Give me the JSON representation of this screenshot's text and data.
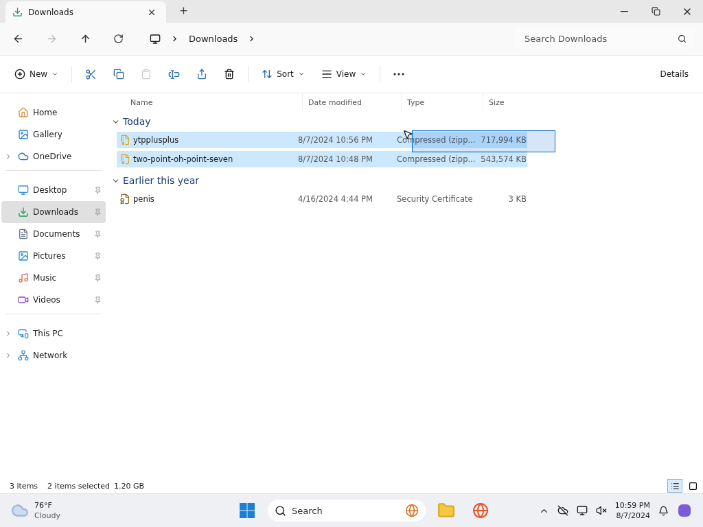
{
  "tab": {
    "title": "Downloads"
  },
  "address": {
    "crumbs": [
      "Downloads"
    ],
    "search_placeholder": "Search Downloads"
  },
  "toolbar": {
    "new": "New",
    "sort": "Sort",
    "view": "View",
    "details": "Details"
  },
  "sidebar": {
    "groups": [
      [
        {
          "label": "Home",
          "kind": "home",
          "expandable": false,
          "pinned": false,
          "selected": false
        },
        {
          "label": "Gallery",
          "kind": "gallery",
          "expandable": false,
          "pinned": false,
          "selected": false
        },
        {
          "label": "OneDrive",
          "kind": "cloud",
          "expandable": true,
          "pinned": false,
          "selected": false
        }
      ],
      [
        {
          "label": "Desktop",
          "kind": "desktop",
          "expandable": false,
          "pinned": true,
          "selected": false
        },
        {
          "label": "Downloads",
          "kind": "downloads",
          "expandable": false,
          "pinned": true,
          "selected": true
        },
        {
          "label": "Documents",
          "kind": "documents",
          "expandable": false,
          "pinned": true,
          "selected": false
        },
        {
          "label": "Pictures",
          "kind": "pictures",
          "expandable": false,
          "pinned": true,
          "selected": false
        },
        {
          "label": "Music",
          "kind": "music",
          "expandable": false,
          "pinned": true,
          "selected": false
        },
        {
          "label": "Videos",
          "kind": "videos",
          "expandable": false,
          "pinned": true,
          "selected": false
        }
      ],
      [
        {
          "label": "This PC",
          "kind": "pc",
          "expandable": true,
          "pinned": false,
          "selected": false
        },
        {
          "label": "Network",
          "kind": "network",
          "expandable": true,
          "pinned": false,
          "selected": false
        }
      ]
    ]
  },
  "columns": [
    "Name",
    "Date modified",
    "Type",
    "Size"
  ],
  "groups": [
    {
      "label": "Today",
      "expanded": true,
      "files": [
        {
          "name": "ytpplusplus",
          "date": "8/7/2024 10:56 PM",
          "type": "Compressed (zipp...",
          "size": "717,994 KB",
          "kind": "zip",
          "selected": true
        },
        {
          "name": "two-point-oh-point-seven",
          "date": "8/7/2024 10:48 PM",
          "type": "Compressed (zipp...",
          "size": "543,574 KB",
          "kind": "zip",
          "selected": true
        }
      ]
    },
    {
      "label": "Earlier this year",
      "expanded": true,
      "files": [
        {
          "name": "penis",
          "date": "4/16/2024 4:44 PM",
          "type": "Security Certificate",
          "size": "3 KB",
          "kind": "certificate",
          "selected": false
        }
      ]
    }
  ],
  "status": {
    "count": "3 items",
    "selection": "2 items selected",
    "selection_size": "1.20 GB",
    "views": [
      {
        "kind": "details",
        "selected": true
      },
      {
        "kind": "tiles",
        "selected": false
      }
    ]
  },
  "taskbar": {
    "temperature": "76°F",
    "condition": "Cloudy",
    "search": "Search",
    "time": "10:59 PM",
    "date": "8/7/2024"
  }
}
